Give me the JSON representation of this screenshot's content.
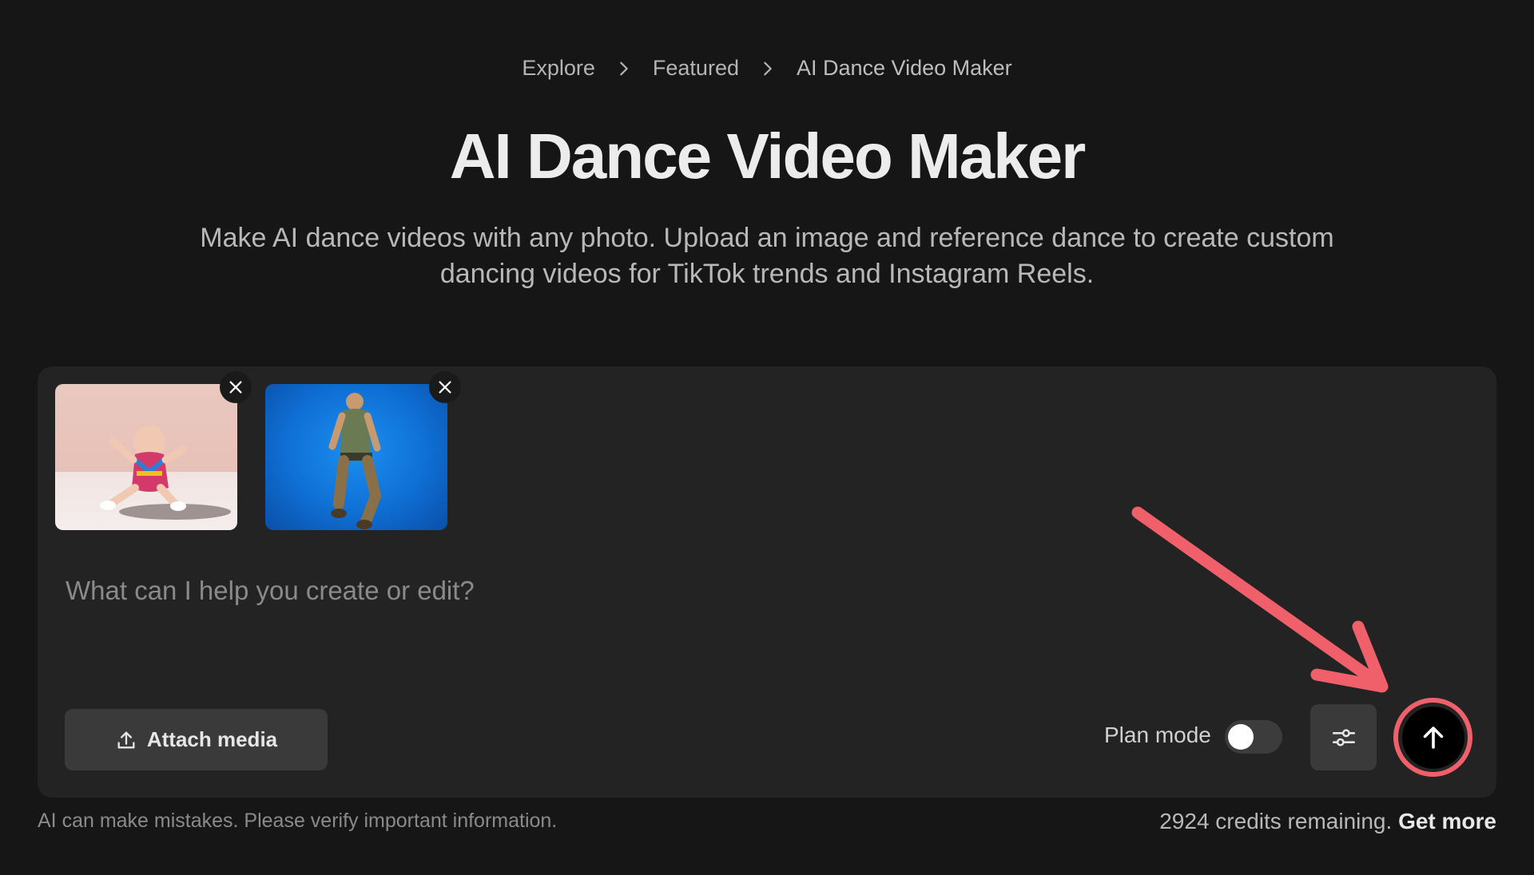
{
  "breadcrumb": {
    "items": [
      "Explore",
      "Featured",
      "AI Dance Video Maker"
    ]
  },
  "page": {
    "title": "AI Dance Video Maker",
    "subtitle": "Make AI dance videos with any photo. Upload an image and reference dance to create custom dancing videos for TikTok trends and Instagram Reels."
  },
  "composer": {
    "attachments": [
      {
        "kind": "image",
        "icon": "baby-photo"
      },
      {
        "kind": "image",
        "icon": "dancer-photo"
      }
    ],
    "prompt_placeholder": "What can I help you create or edit?",
    "prompt_value": "",
    "attach_label": "Attach media",
    "plan_mode_label": "Plan mode",
    "plan_mode_on": false,
    "settings_icon": "sliders-icon",
    "send_icon": "arrow-up-icon"
  },
  "footer": {
    "disclaimer": "AI can make mistakes. Please verify important information.",
    "credits_text": "2924 credits remaining.",
    "get_more_label": "Get more"
  },
  "colors": {
    "background": "#161616",
    "card": "#232323",
    "annotation": "#f0606a"
  }
}
